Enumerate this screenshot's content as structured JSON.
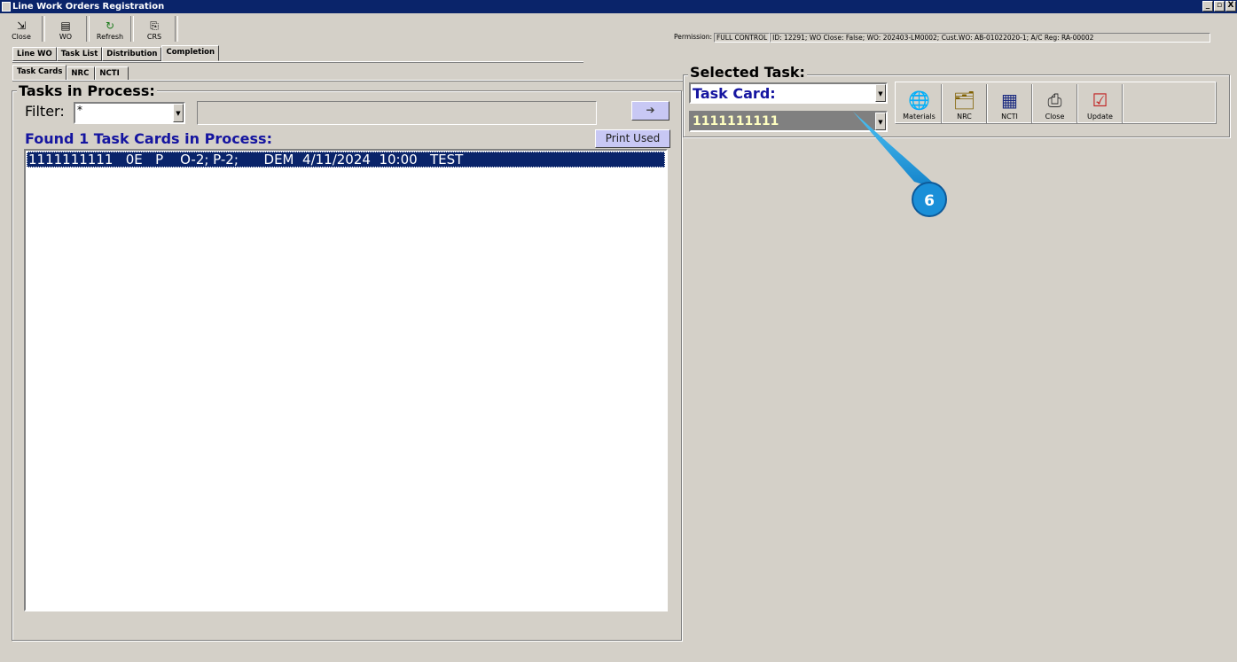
{
  "window": {
    "title": "Line Work Orders Registration",
    "controls": [
      "_",
      "▫",
      "X"
    ]
  },
  "toolbar": [
    {
      "label": "Close",
      "icon": "door-exit-icon",
      "glyph": "⇲"
    },
    {
      "label": "WO",
      "icon": "printer-icon",
      "glyph": "▤"
    },
    {
      "label": "Refresh",
      "icon": "refresh-arrow-icon",
      "glyph": "↻"
    },
    {
      "label": "CRS",
      "icon": "report-icon",
      "glyph": "⎘"
    }
  ],
  "status": {
    "permission_label": "Permission:",
    "permission_value": "FULL CONTROL",
    "info": "ID: 12291; WO Close: False; WO: 202403-LM0002; Cust.WO: AB-01022020-1; A/C Reg: RA-00002"
  },
  "tabs_main": [
    "Line WO",
    "Task List",
    "Distribution",
    "Completion"
  ],
  "tabs_main_active": "Completion",
  "tabs_sub": [
    "Task Cards",
    "NRC",
    "NCTI"
  ],
  "tabs_sub_active": "Task Cards",
  "tasks_in_process": {
    "title": "Tasks in Process:",
    "filter_label": "Filter:",
    "filter_value": "*",
    "go_button": "➔",
    "found_label": "Found 1 Task Cards in Process:",
    "print_button": "Print Used",
    "rows": [
      "1111111111   0E   P    O-2; P-2;      DEM  4/11/2024  10:00   TEST"
    ]
  },
  "selected_task": {
    "title": "Selected Task:",
    "type_value": "Task Card:",
    "task_number": "1111111111",
    "actions": [
      {
        "label": "Materials",
        "icon": "materials-globe-icon",
        "glyph": "🌐",
        "color": "#1a7a1a"
      },
      {
        "label": "NRC",
        "icon": "document-stack-icon",
        "glyph": "🗂",
        "color": "#806000"
      },
      {
        "label": "NCTI",
        "icon": "grid-form-icon",
        "glyph": "▦",
        "color": "#1a2a80"
      },
      {
        "label": "Close",
        "icon": "close-document-icon",
        "glyph": "⎙",
        "color": "#303030"
      },
      {
        "label": "Update",
        "icon": "checklist-icon",
        "glyph": "☑",
        "color": "#c02020"
      }
    ]
  },
  "callout": {
    "number": "6",
    "color": "#1aa3e8"
  }
}
